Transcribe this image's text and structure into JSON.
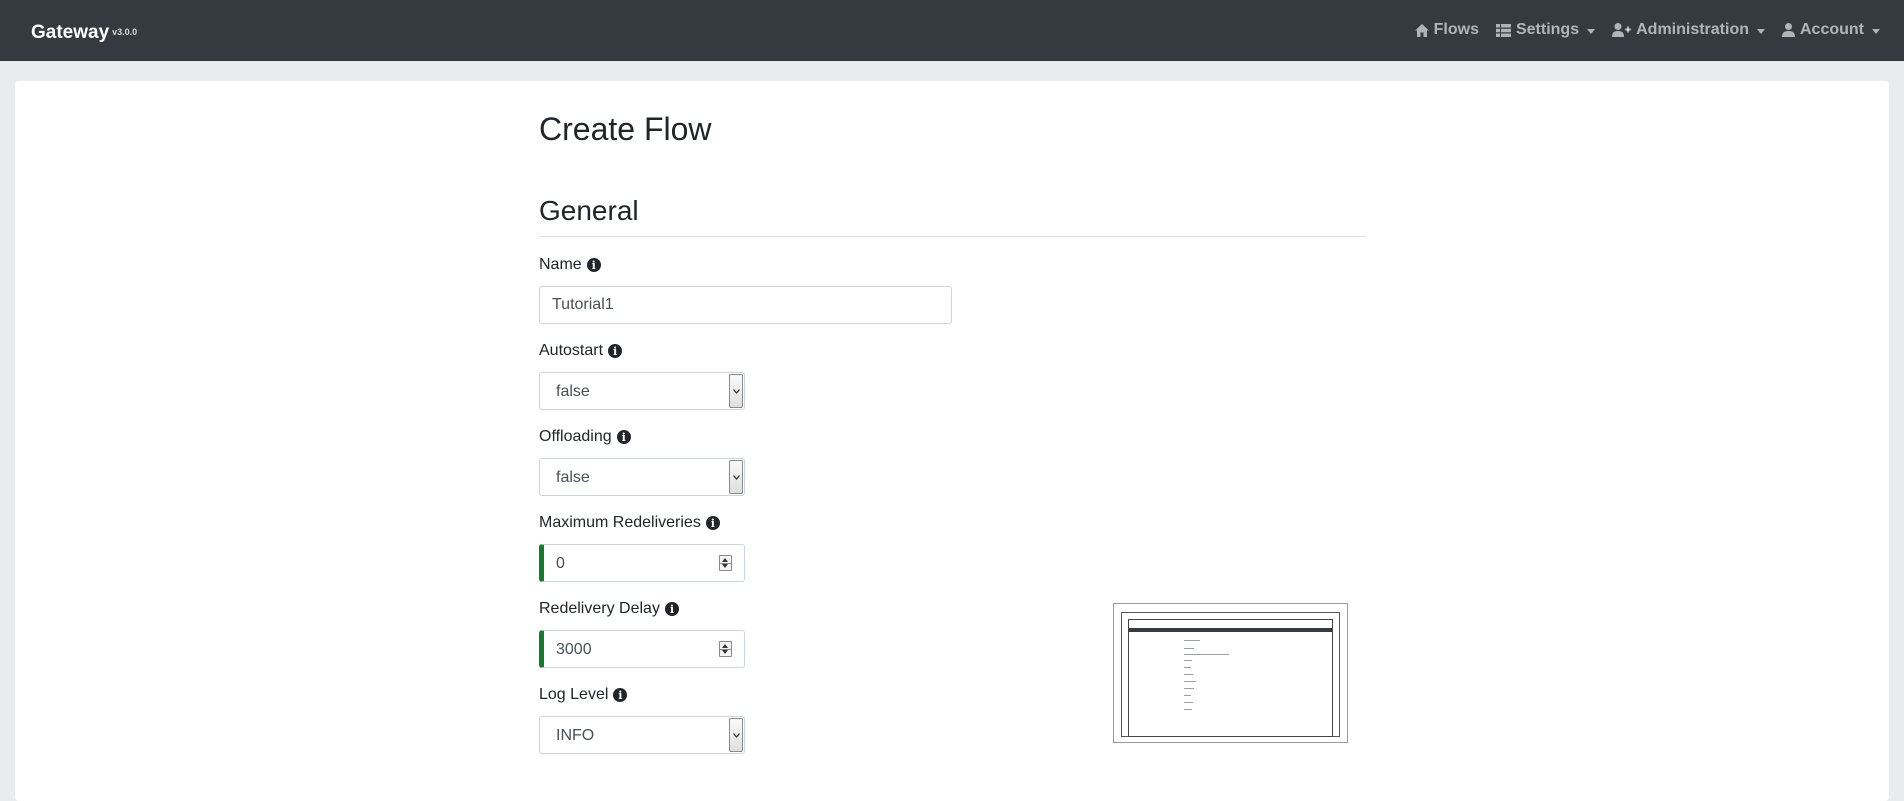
{
  "navbar": {
    "brand": "Gateway",
    "version": "v3.0.0",
    "items": [
      {
        "label": "Flows",
        "icon": "home-icon",
        "dropdown": false
      },
      {
        "label": "Settings",
        "icon": "table-list-icon",
        "dropdown": true
      },
      {
        "label": "Administration",
        "icon": "user-plus-icon",
        "dropdown": true
      },
      {
        "label": "Account",
        "icon": "user-icon",
        "dropdown": true
      }
    ]
  },
  "page": {
    "title": "Create Flow",
    "section": "General"
  },
  "form": {
    "name": {
      "label": "Name",
      "value": "Tutorial1",
      "icon": "info-circle-icon"
    },
    "autostart": {
      "label": "Autostart",
      "value": "false",
      "icon": "info-circle-icon"
    },
    "offloading": {
      "label": "Offloading",
      "value": "false",
      "icon": "info-circle-icon"
    },
    "max_redeliveries": {
      "label": "Maximum Redeliveries",
      "value": "0",
      "icon": "info-circle-icon"
    },
    "redelivery_delay": {
      "label": "Redelivery Delay",
      "value": "3000",
      "icon": "info-circle-icon"
    },
    "log_level": {
      "label": "Log Level",
      "value": "INFO",
      "icon": "info-circle-icon"
    }
  },
  "colors": {
    "navbar_bg": "#343a40",
    "page_bg": "#e9ecef",
    "valid_accent": "#157a2e"
  }
}
